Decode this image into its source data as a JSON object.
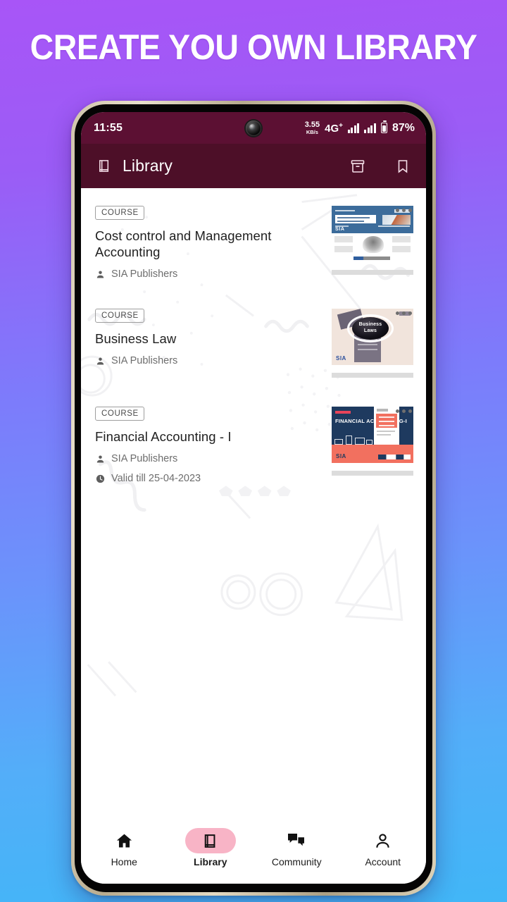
{
  "promo": {
    "headline": "CREATE YOU OWN LIBRARY"
  },
  "status_bar": {
    "time": "11:55",
    "net_speed_value": "3.55",
    "net_speed_unit": "KB/s",
    "network": "4G",
    "network_sup": "+",
    "battery_percent": "87%"
  },
  "app_bar": {
    "title": "Library",
    "book_icon": "book-icon",
    "archive_icon": "archive-icon",
    "bookmark_icon": "bookmark-icon"
  },
  "library": {
    "items": [
      {
        "badge": "COURSE",
        "title": "Cost control and Management Accounting",
        "author": "SIA Publishers",
        "validity": "",
        "thumb_title": "SIA"
      },
      {
        "badge": "COURSE",
        "title": "Business Law",
        "author": "SIA Publishers",
        "validity": "",
        "thumb_title": "Business Laws",
        "thumb_brand": "SIA"
      },
      {
        "badge": "COURSE",
        "title": "Financial Accounting - I",
        "author": "SIA Publishers",
        "validity": "Valid till 25-04-2023",
        "thumb_title": "FINANCIAL ACCOUNTING-I",
        "thumb_brand": "SIA"
      }
    ],
    "overflow_icon": "more-options-icon",
    "author_icon": "person-icon",
    "clock_icon": "clock-icon"
  },
  "bottom_nav": {
    "items": [
      {
        "label": "Home",
        "icon": "home-icon",
        "active": false
      },
      {
        "label": "Library",
        "icon": "book-icon",
        "active": true
      },
      {
        "label": "Community",
        "icon": "chat-icon",
        "active": false
      },
      {
        "label": "Account",
        "icon": "person-icon",
        "active": false
      }
    ]
  },
  "colors": {
    "status_bar": "#5c1033",
    "app_bar": "#4d0f28",
    "accent_pink": "#f8b4c6",
    "bg_gradient_top": "#a855f7",
    "bg_gradient_bottom": "#41b6f7"
  }
}
